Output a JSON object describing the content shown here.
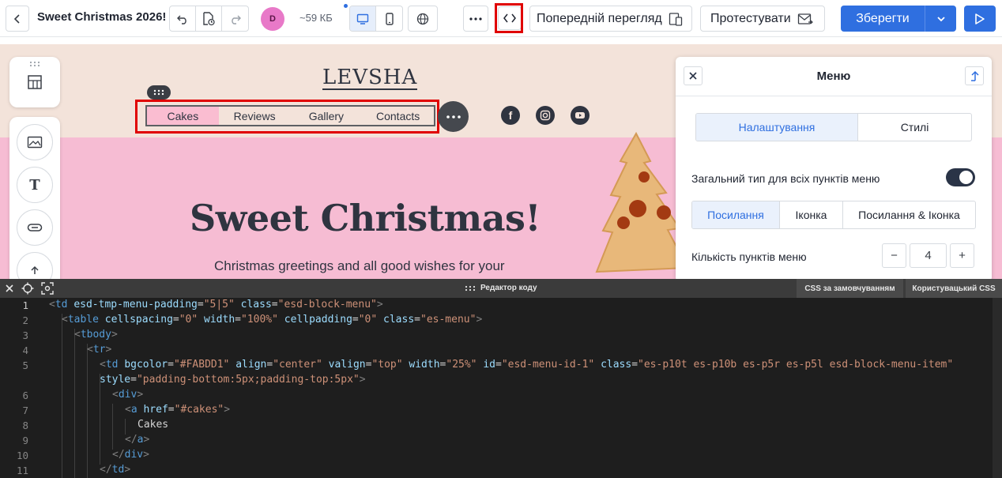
{
  "toolbar": {
    "title": "Sweet Christmas 2026!",
    "avatar_initial": "D",
    "size_label": "~59 КБ",
    "preview_label": "Попередній перегляд",
    "test_label": "Протестувати",
    "save_label": "Зберегти"
  },
  "email": {
    "logo": "LEVSHA",
    "menu": [
      {
        "label": "Cakes",
        "active": true
      },
      {
        "label": "Reviews",
        "active": false
      },
      {
        "label": "Gallery",
        "active": false
      },
      {
        "label": "Contacts",
        "active": false
      }
    ],
    "menu_active_bg": "#FABDD1",
    "social_icons": [
      "facebook-icon",
      "instagram-icon",
      "youtube-icon"
    ],
    "hero_title": "Sweet Christmas!",
    "hero_subtitle": "Christmas greetings and all good wishes for your",
    "hero_bg": "#f6bcd3",
    "header_bg": "#f3e3da"
  },
  "panel": {
    "title": "Меню",
    "tabs": [
      "Налаштування",
      "Стилі"
    ],
    "active_tab": 0,
    "toggle_label": "Загальний тип для всіх пунктів меню",
    "toggle_on": true,
    "type_options": [
      "Посилання",
      "Іконка",
      "Посилання & Іконка"
    ],
    "active_type": 0,
    "count_label": "Кількість пунктів меню",
    "count_value": "4",
    "minus": "−",
    "plus": "+"
  },
  "editor": {
    "title": "Редактор коду",
    "default_css_label": "CSS за замовчуванням",
    "custom_css_label": "Користувацький CSS",
    "line_numbers": [
      "1",
      "2",
      "3",
      "4",
      "5",
      "",
      "6",
      "7",
      "8",
      "9",
      "10",
      "11"
    ],
    "lines": [
      "<td esd-tmp-menu-padding=\"5|5\" class=\"esd-block-menu\">",
      "<table cellspacing=\"0\" width=\"100%\" cellpadding=\"0\" class=\"es-menu\">",
      "<tbody>",
      "<tr>",
      "<td bgcolor=\"#FABDD1\" align=\"center\" valign=\"top\" width=\"25%\" id=\"esd-menu-id-1\" class=\"es-p10t es-p10b es-p5r es-p5l esd-block-menu-item\"",
      "style=\"padding-bottom:5px;padding-top:5px\">",
      "<div>",
      "<a href=\"#cakes\">",
      "Cakes",
      "</a>",
      "</div>",
      "</td>"
    ]
  },
  "colors": {
    "accent": "#2f6fe0",
    "highlight": "#e00000",
    "editor_bg": "#1e1e1e"
  }
}
